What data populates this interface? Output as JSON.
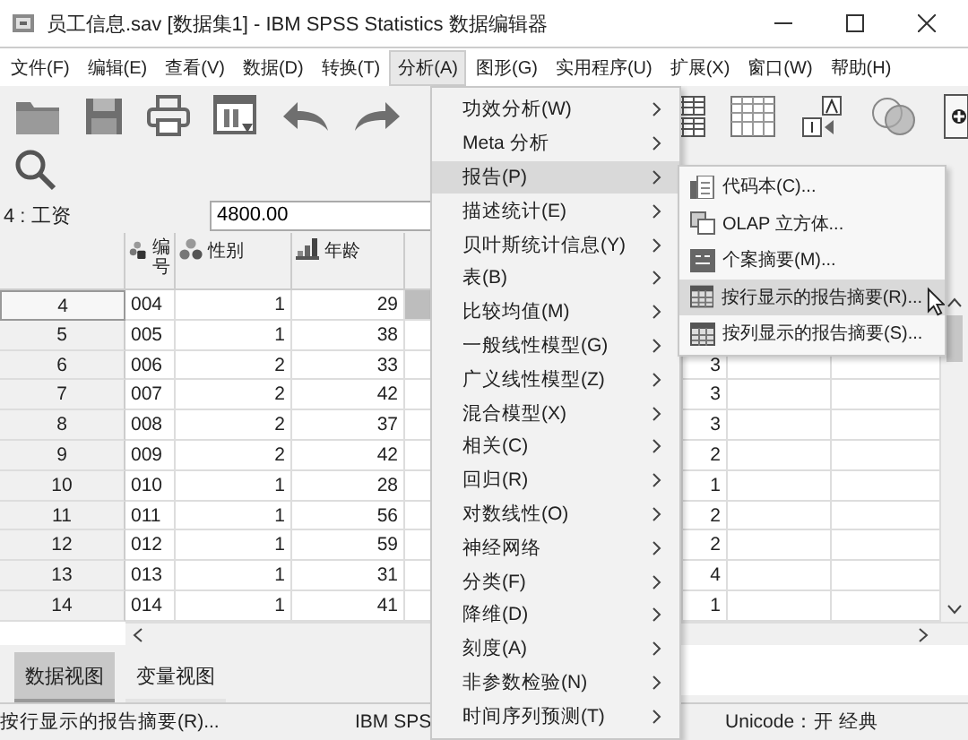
{
  "window": {
    "title": "员工信息.sav [数据集1] - IBM SPSS Statistics 数据编辑器"
  },
  "menu_bar": [
    {
      "label": "文件(F)",
      "selected": false
    },
    {
      "label": "编辑(E)",
      "selected": false
    },
    {
      "label": "查看(V)",
      "selected": false
    },
    {
      "label": "数据(D)",
      "selected": false
    },
    {
      "label": "转换(T)",
      "selected": false
    },
    {
      "label": "分析(A)",
      "selected": true
    },
    {
      "label": "图形(G)",
      "selected": false
    },
    {
      "label": "实用程序(U)",
      "selected": false
    },
    {
      "label": "扩展(X)",
      "selected": false
    },
    {
      "label": "窗口(W)",
      "selected": false
    },
    {
      "label": "帮助(H)",
      "selected": false
    }
  ],
  "cell_editor": {
    "cell": "4 : 工资",
    "value": "4800.00"
  },
  "table": {
    "columns": [
      {
        "label": "编号",
        "kind": "string"
      },
      {
        "label": "性别",
        "kind": "nominal"
      },
      {
        "label": "年龄",
        "kind": "scale"
      }
    ],
    "rows": [
      {
        "row": "4",
        "code": "004",
        "gender": "1",
        "age": "29",
        "selected": true
      },
      {
        "row": "5",
        "code": "005",
        "gender": "1",
        "age": "38",
        "selected": false
      },
      {
        "row": "6",
        "code": "006",
        "gender": "2",
        "age": "33",
        "column_6": "3",
        "selected": false
      },
      {
        "row": "7",
        "code": "007",
        "gender": "2",
        "age": "42",
        "column_6": "3",
        "selected": false
      },
      {
        "row": "8",
        "code": "008",
        "gender": "2",
        "age": "37",
        "column_6": "3",
        "selected": false
      },
      {
        "row": "9",
        "code": "009",
        "gender": "2",
        "age": "42",
        "column_6": "2",
        "selected": false
      },
      {
        "row": "10",
        "code": "010",
        "gender": "1",
        "age": "28",
        "column_6": "1",
        "selected": false
      },
      {
        "row": "11",
        "code": "011",
        "gender": "1",
        "age": "56",
        "column_6": "2",
        "selected": false
      },
      {
        "row": "12",
        "code": "012",
        "gender": "1",
        "age": "59",
        "column_6": "2",
        "selected": false
      },
      {
        "row": "13",
        "code": "013",
        "gender": "1",
        "age": "31",
        "column_6": "4",
        "selected": false
      },
      {
        "row": "14",
        "code": "014",
        "gender": "1",
        "age": "41",
        "column_6": "1",
        "selected": false
      }
    ]
  },
  "view_tabs": [
    {
      "label": "数据视图",
      "selected": true
    },
    {
      "label": "变量视图",
      "selected": false
    }
  ],
  "status_bar": {
    "message": "按行显示的报告摘要(R)...",
    "processor": "IBM SPS",
    "unicode": "Unicode：开 经典"
  },
  "analyze_menu": [
    {
      "label": "功效分析(W)",
      "selected": false
    },
    {
      "label": "Meta 分析",
      "selected": false
    },
    {
      "label": "报告(P)",
      "selected": true
    },
    {
      "label": "描述统计(E)",
      "selected": false
    },
    {
      "label": "贝叶斯统计信息(Y)",
      "selected": false
    },
    {
      "label": "表(B)",
      "selected": false
    },
    {
      "label": "比较均值(M)",
      "selected": false
    },
    {
      "label": "一般线性模型(G)",
      "selected": false
    },
    {
      "label": "广义线性模型(Z)",
      "selected": false
    },
    {
      "label": "混合模型(X)",
      "selected": false
    },
    {
      "label": "相关(C)",
      "selected": false
    },
    {
      "label": "回归(R)",
      "selected": false
    },
    {
      "label": "对数线性(O)",
      "selected": false
    },
    {
      "label": "神经网络",
      "selected": false
    },
    {
      "label": "分类(F)",
      "selected": false
    },
    {
      "label": "降维(D)",
      "selected": false
    },
    {
      "label": "刻度(A)",
      "selected": false
    },
    {
      "label": "非参数检验(N)",
      "selected": false
    },
    {
      "label": "时间序列预测(T)",
      "selected": false
    }
  ],
  "reports_submenu": [
    {
      "label": "代码本(C)...",
      "kind": "codebook",
      "selected": false
    },
    {
      "label": "OLAP 立方体...",
      "kind": "olap",
      "selected": false
    },
    {
      "label": "个案摘要(M)...",
      "kind": "summary",
      "selected": false
    },
    {
      "label": "按行显示的报告摘要(R)...",
      "kind": "rows",
      "selected": true
    },
    {
      "label": "按列显示的报告摘要(S)...",
      "kind": "columns",
      "selected": false
    }
  ]
}
